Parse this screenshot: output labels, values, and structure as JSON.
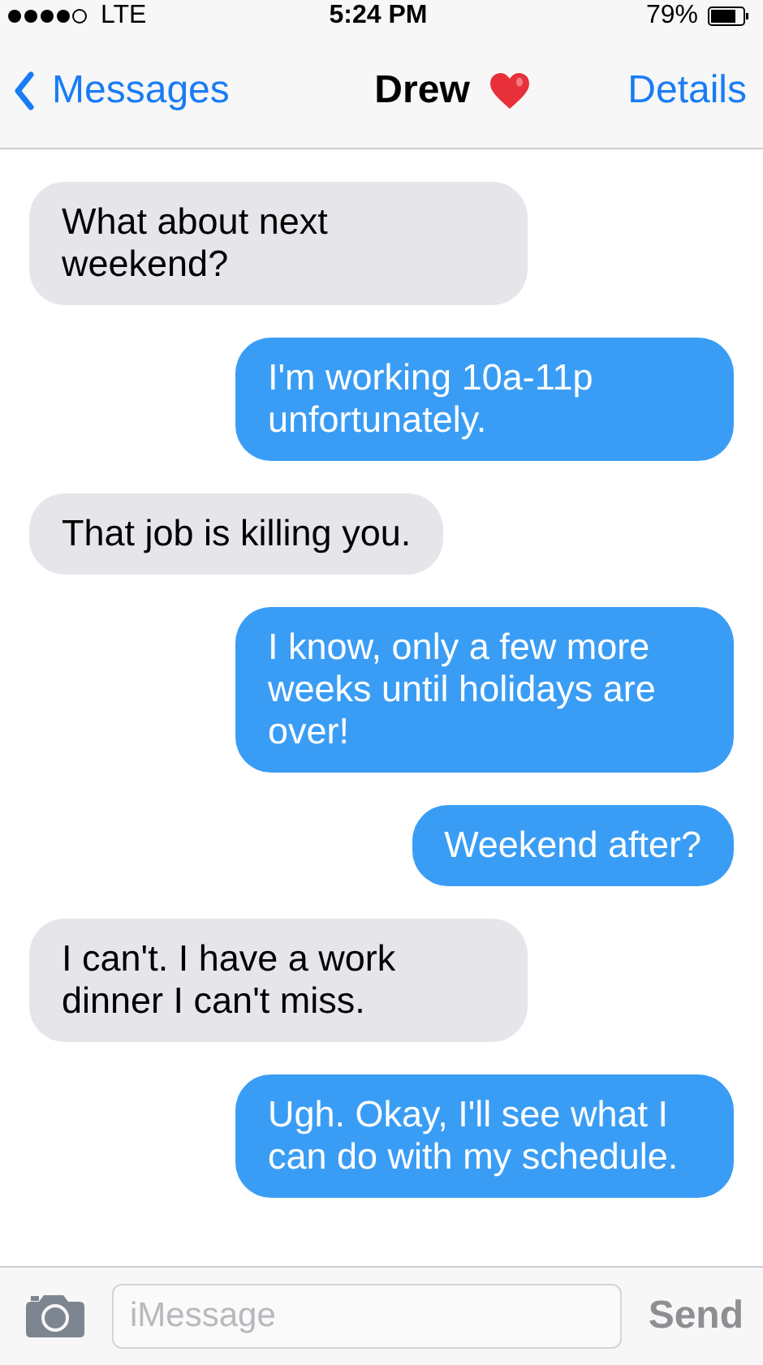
{
  "status_bar": {
    "carrier": "LTE",
    "time": "5:24 PM",
    "battery": "79%"
  },
  "nav": {
    "back": "Messages",
    "title": "Drew",
    "action": "Details"
  },
  "messages": [
    {
      "kind": "received",
      "text": "What about next weekend?"
    },
    {
      "kind": "sent",
      "text": "I'm working 10a-11p unfortunately."
    },
    {
      "kind": "received",
      "text": "That job is killing you."
    },
    {
      "kind": "sent",
      "text": "I know, only a few more weeks until holidays are over!"
    },
    {
      "kind": "sent",
      "text": "Weekend after?"
    },
    {
      "kind": "received",
      "text": "I can't. I have a work dinner I can't miss."
    },
    {
      "kind": "sent",
      "text": "Ugh. Okay, I'll see what I can do with my schedule."
    }
  ],
  "composer": {
    "placeholder": "iMessage",
    "send": "Send"
  }
}
